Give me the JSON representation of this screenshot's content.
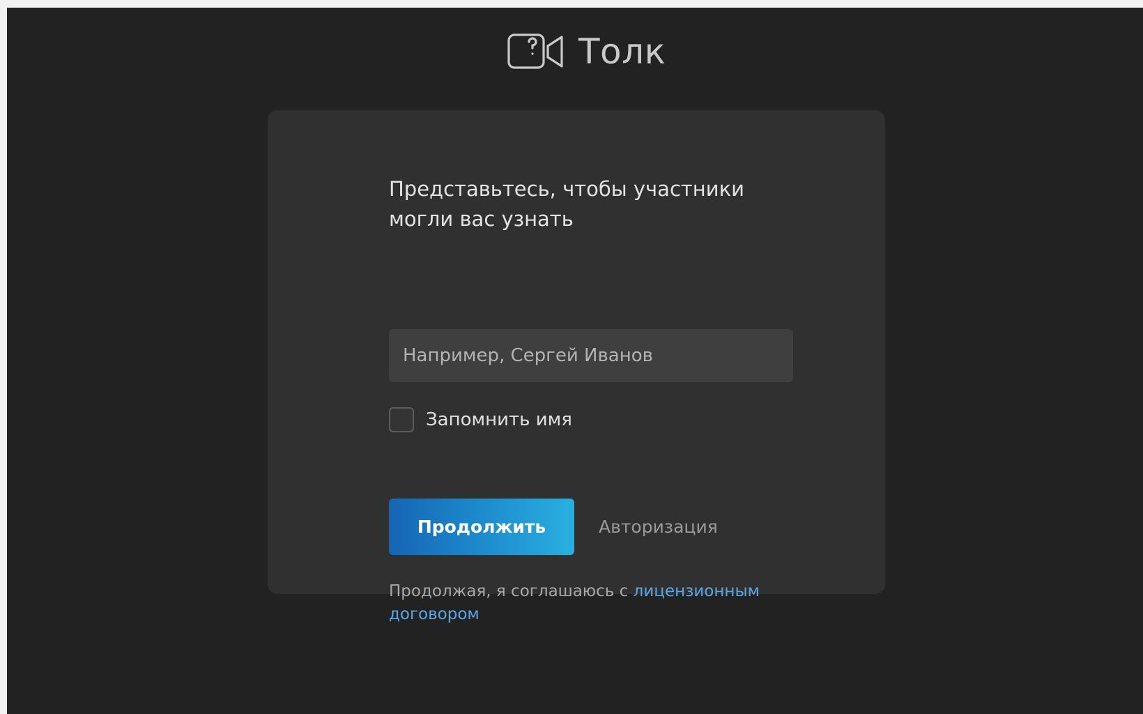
{
  "app": {
    "name": "Толк",
    "logo_icon": "video-camera-question-icon"
  },
  "form": {
    "heading": "Представьтесь, чтобы участники могли вас узнать",
    "name_input": {
      "value": "",
      "placeholder": "Например, Сергей Иванов"
    },
    "remember": {
      "label": "Запомнить имя",
      "checked": false
    },
    "continue_label": "Продолжить",
    "auth_label": "Авторизация",
    "legal": {
      "prefix": "Продолжая, я соглашаюсь с ",
      "link_text": "лицензионным договором"
    }
  },
  "colors": {
    "background": "#222222",
    "card": "#303030",
    "accent_start": "#1565b3",
    "accent_end": "#29afdf",
    "link": "#5aa6e6"
  }
}
